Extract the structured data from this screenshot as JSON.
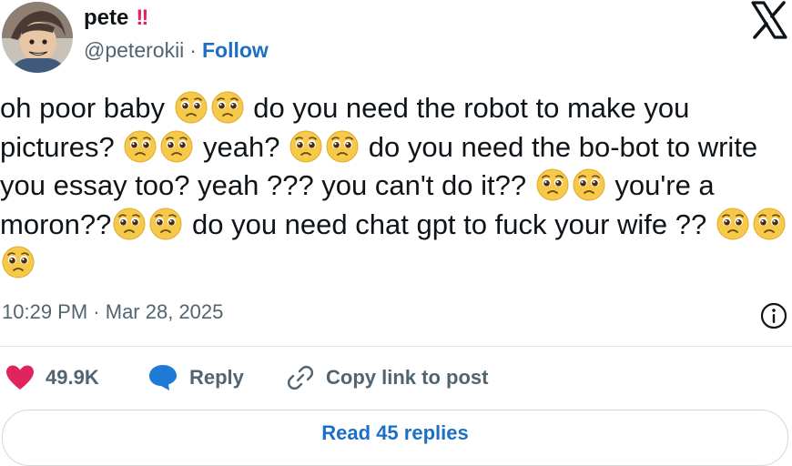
{
  "author": {
    "name": "pete",
    "badge": "!!",
    "handle": "@peterokii",
    "separator": "·",
    "follow_label": "Follow"
  },
  "tweet": {
    "segments": [
      "oh poor baby",
      "do you need the robot to make you pictures?",
      "yeah?",
      "do you need the bo-bot to write you essay too? yeah ??? you can't do it??",
      "you're a moron??",
      "do you need chat gpt to fuck your wife ??"
    ],
    "emoji_name": "pleading-face-icon"
  },
  "meta": {
    "time": "10:29 PM",
    "separator": "·",
    "date": "Mar 28, 2025"
  },
  "actions": {
    "likes": "49.9K",
    "reply_label": "Reply",
    "copy_label": "Copy link to post"
  },
  "footer": {
    "read_replies_label": "Read 45 replies"
  },
  "colors": {
    "like": "#e0245e",
    "reply": "#1d7ad6",
    "link": "#1d6fc5",
    "muted": "#536471",
    "emoji": "#f5c242"
  }
}
